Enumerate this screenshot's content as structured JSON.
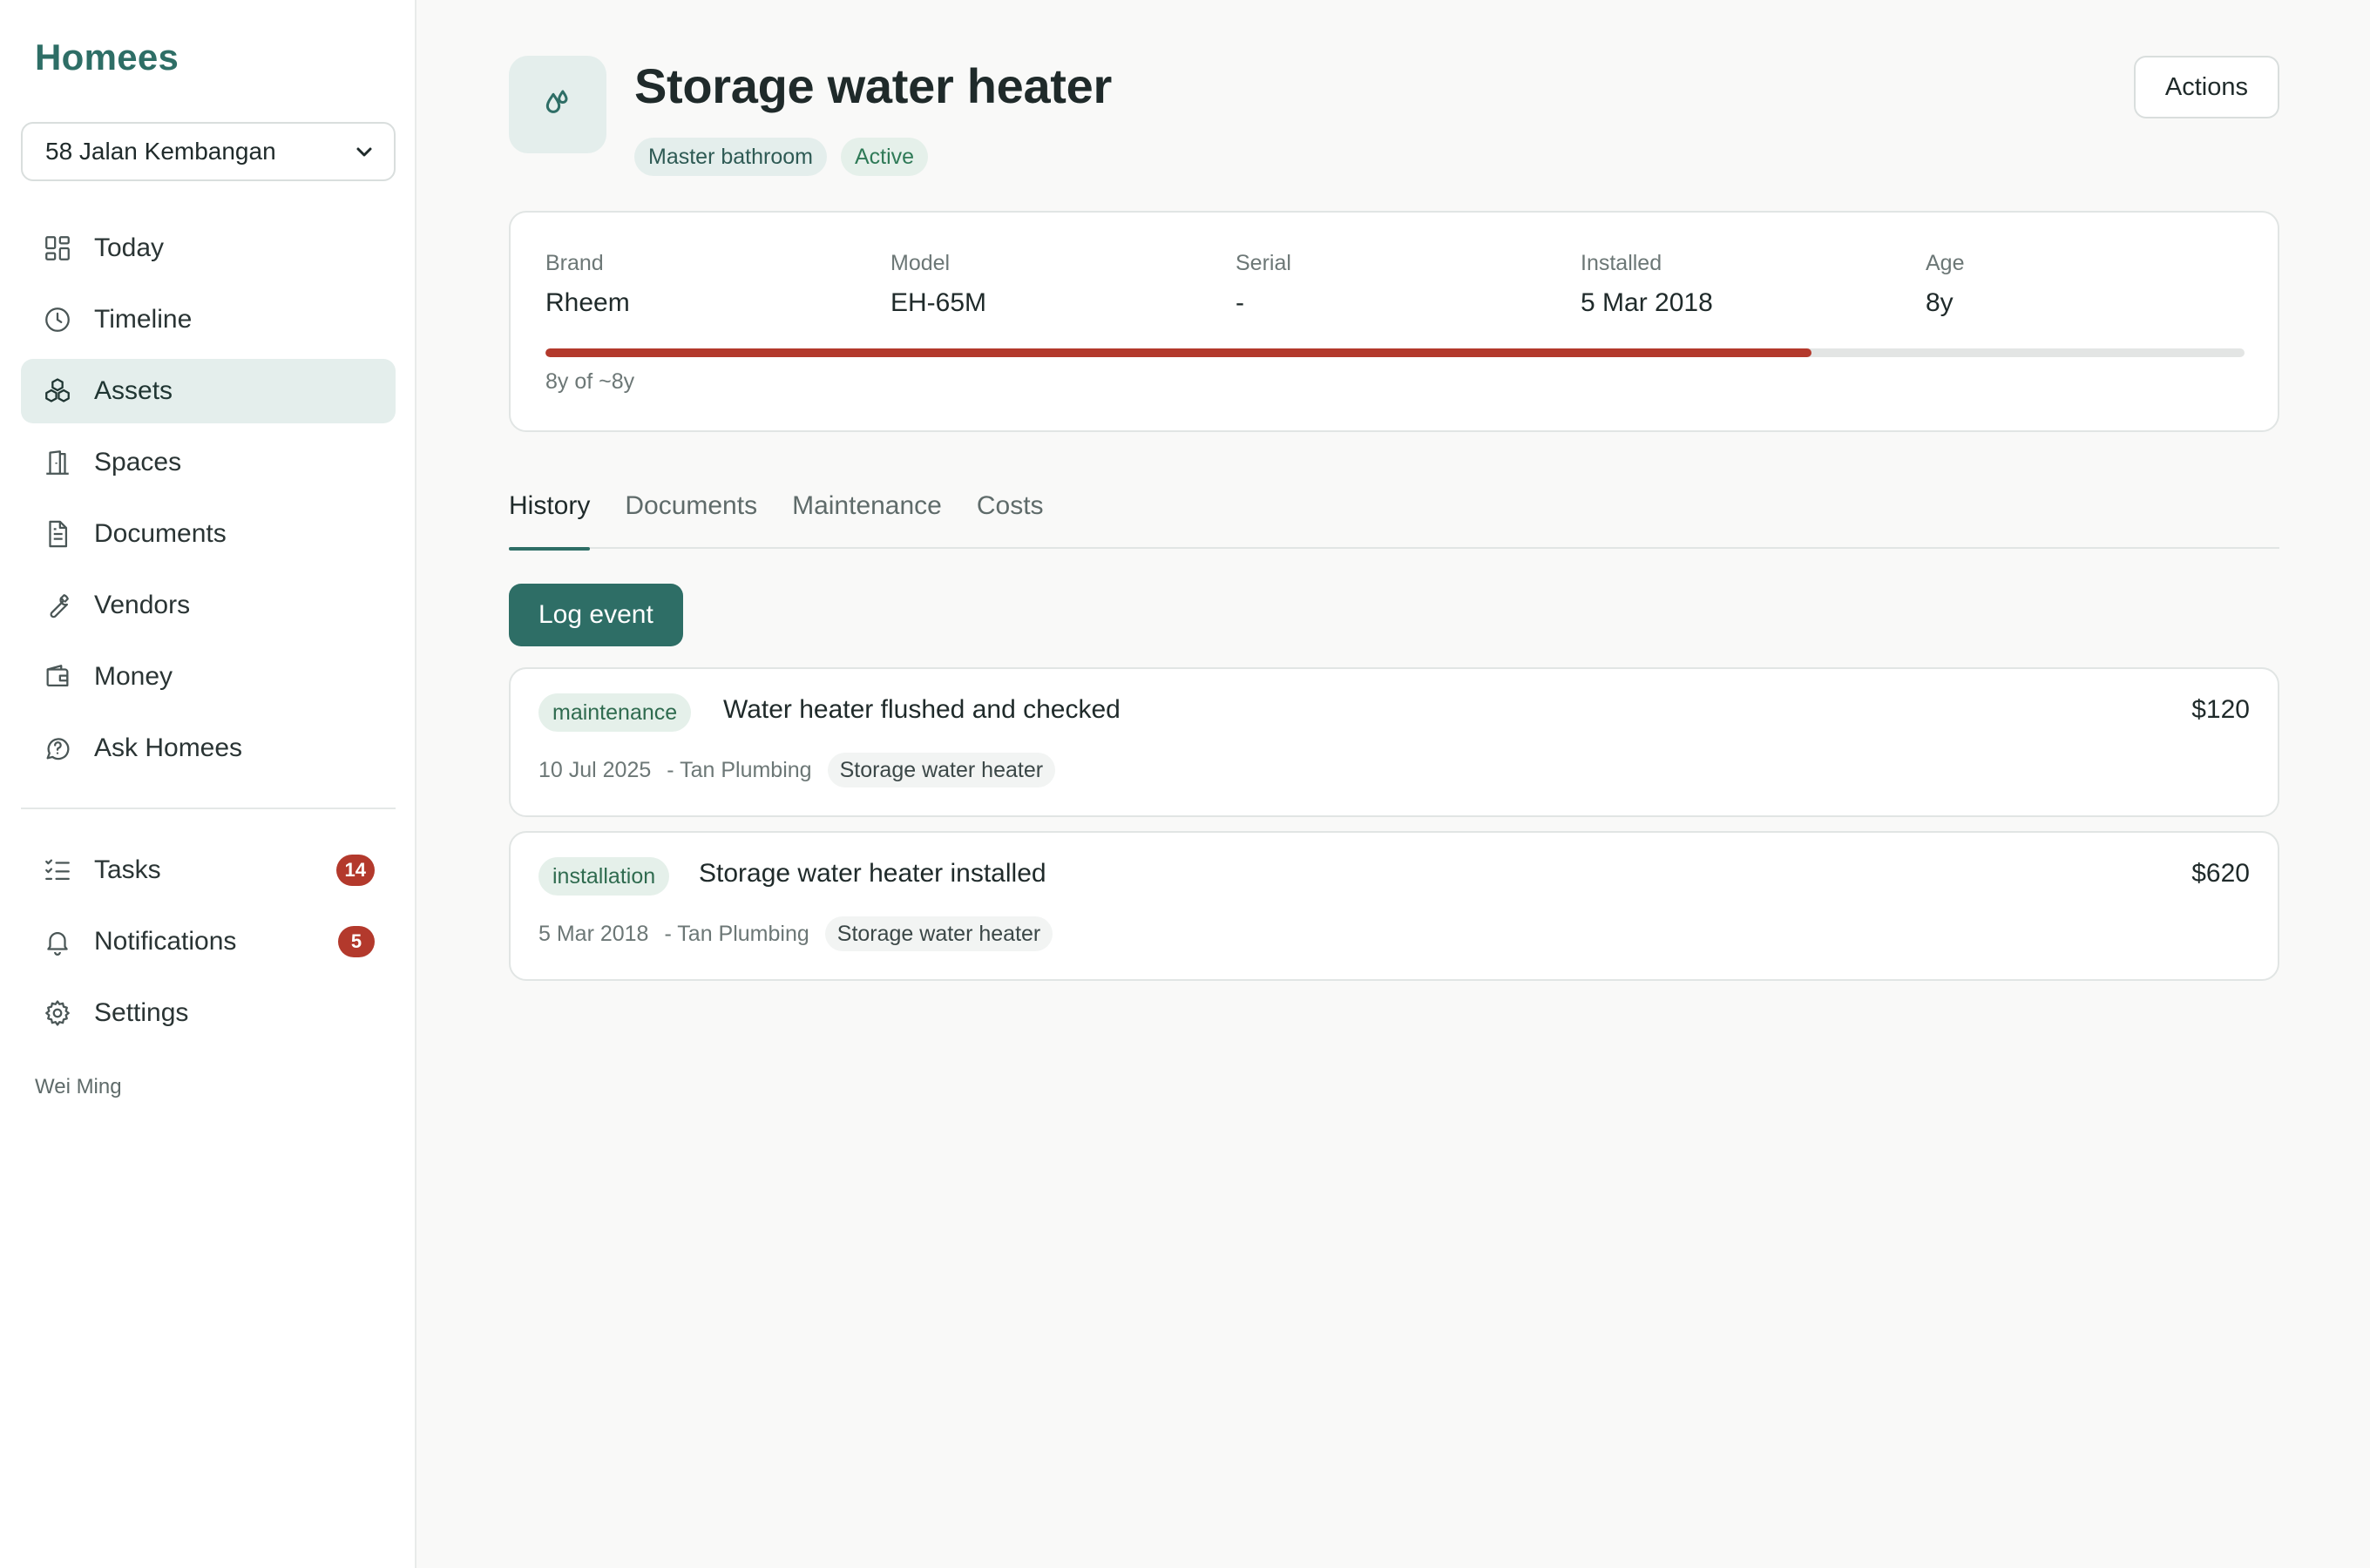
{
  "app": {
    "brand": "Homees",
    "user": "Wei Ming"
  },
  "property_select": {
    "value": "58 Jalan Kembangan"
  },
  "nav": [
    {
      "label": "Today",
      "icon": "dashboard-icon"
    },
    {
      "label": "Timeline",
      "icon": "clock-icon"
    },
    {
      "label": "Assets",
      "icon": "boxes-icon",
      "active": true
    },
    {
      "label": "Spaces",
      "icon": "door-icon"
    },
    {
      "label": "Documents",
      "icon": "document-icon"
    },
    {
      "label": "Vendors",
      "icon": "wrench-icon"
    },
    {
      "label": "Money",
      "icon": "wallet-icon"
    },
    {
      "label": "Ask Homees",
      "icon": "chat-question-icon"
    }
  ],
  "nav_secondary": [
    {
      "label": "Tasks",
      "icon": "task-list-icon",
      "badge": "14"
    },
    {
      "label": "Notifications",
      "icon": "bell-icon",
      "badge": "5"
    },
    {
      "label": "Settings",
      "icon": "gear-icon"
    }
  ],
  "asset": {
    "title": "Storage water heater",
    "location": "Master bathroom",
    "status": "Active",
    "actions_label": "Actions",
    "specs": [
      {
        "label": "Brand",
        "value": "Rheem"
      },
      {
        "label": "Model",
        "value": "EH-65M"
      },
      {
        "label": "Serial",
        "value": "-"
      },
      {
        "label": "Installed",
        "value": "5 Mar 2018"
      },
      {
        "label": "Age",
        "value": "8y"
      }
    ],
    "lifespan_fraction": 0.745,
    "lifespan_text": "8y of ~8y"
  },
  "tabs": [
    {
      "label": "History",
      "active": true
    },
    {
      "label": "Documents"
    },
    {
      "label": "Maintenance"
    },
    {
      "label": "Costs"
    }
  ],
  "log_event_label": "Log event",
  "events": [
    {
      "kind": "maintenance",
      "title": "Water heater flushed and checked",
      "amount": "$120",
      "date": "10 Jul 2025",
      "vendor": "- Tan Plumbing",
      "asset": "Storage water heater"
    },
    {
      "kind": "installation",
      "title": "Storage water heater installed",
      "amount": "$620",
      "date": "5 Mar 2018",
      "vendor": "- Tan Plumbing",
      "asset": "Storage water heater"
    }
  ],
  "colors": {
    "brand": "#2e6e66",
    "alert": "#b3392c",
    "active_nav_bg": "#e4eeec"
  }
}
